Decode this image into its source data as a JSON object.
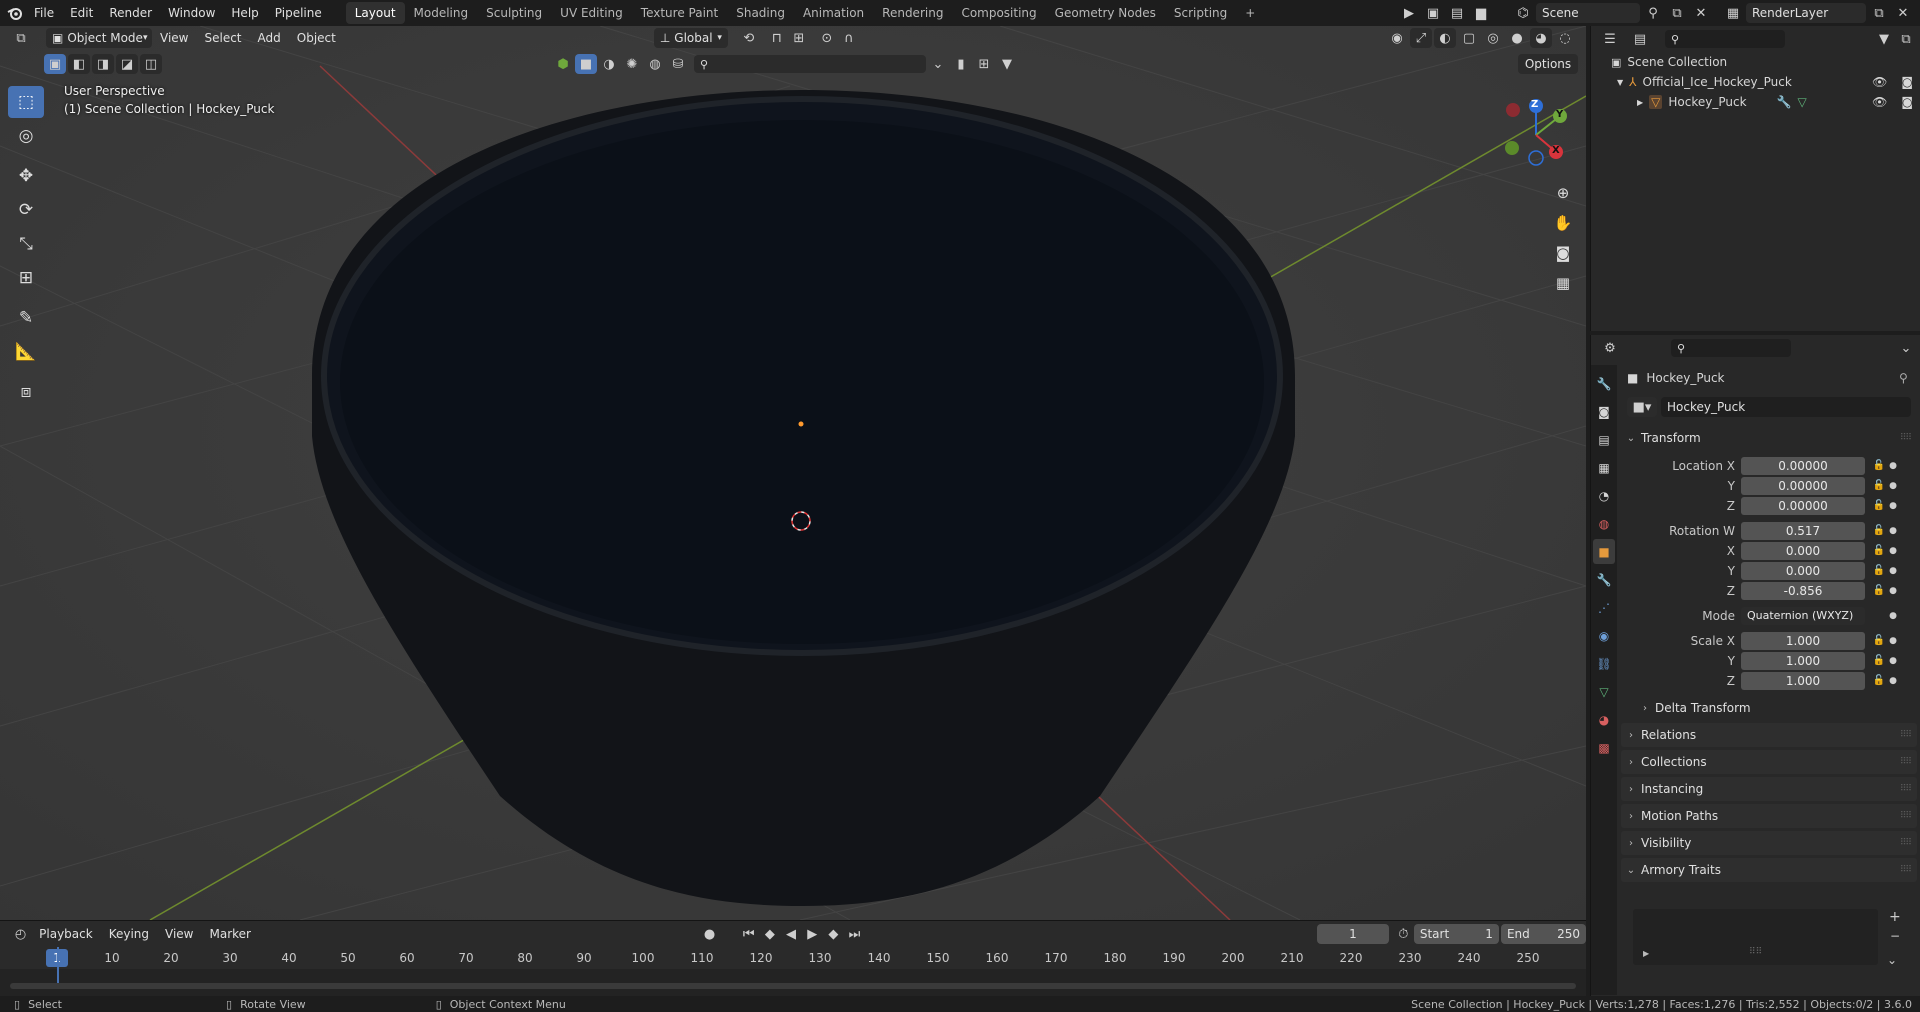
{
  "topbar": {
    "menus": [
      "File",
      "Edit",
      "Render",
      "Window",
      "Help",
      "Pipeline"
    ],
    "workspaces": [
      "Layout",
      "Modeling",
      "Sculpting",
      "UV Editing",
      "Texture Paint",
      "Shading",
      "Animation",
      "Rendering",
      "Compositing",
      "Geometry Nodes",
      "Scripting"
    ],
    "active_workspace": "Layout",
    "add_workspace": "+",
    "scene_name": "Scene",
    "view_layer": "RenderLayer"
  },
  "viewport": {
    "mode": "Object Mode",
    "menus": [
      "View",
      "Select",
      "Add",
      "Object"
    ],
    "transform_orientation": "Global",
    "options_label": "Options",
    "view_name": "User Perspective",
    "collection_info": "(1) Scene Collection | Hockey_Puck",
    "gizmo_axes": {
      "x": "X",
      "y": "Y",
      "z": "Z"
    }
  },
  "outliner": {
    "root": "Scene Collection",
    "items": [
      {
        "name": "Official_Ice_Hockey_Puck",
        "level": 1
      },
      {
        "name": "Hockey_Puck",
        "level": 2
      }
    ]
  },
  "properties": {
    "object_name": "Hockey_Puck",
    "data_name": "Hockey_Puck",
    "transform_header": "Transform",
    "location": {
      "label": "Location X",
      "x": "0.00000",
      "y": "0.00000",
      "z": "0.00000"
    },
    "rotation": {
      "label": "Rotation W",
      "w": "0.517",
      "x": "0.000",
      "y": "0.000",
      "z": "-0.856"
    },
    "mode_label": "Mode",
    "mode_value": "Quaternion (WXYZ)",
    "scale": {
      "label": "Scale X",
      "x": "1.000",
      "y": "1.000",
      "z": "1.000"
    },
    "axis_labels": {
      "x": "X",
      "y": "Y",
      "z": "Z"
    },
    "delta_transform": "Delta Transform",
    "panels": [
      "Relations",
      "Collections",
      "Instancing",
      "Motion Paths",
      "Visibility"
    ],
    "armory_traits": "Armory Traits"
  },
  "timeline": {
    "menus": [
      "Playback",
      "Keying",
      "View",
      "Marker"
    ],
    "current_frame": "1",
    "start_label": "Start",
    "start_value": "1",
    "end_label": "End",
    "end_value": "250",
    "ticks": [
      "10",
      "20",
      "30",
      "40",
      "50",
      "60",
      "70",
      "80",
      "90",
      "100",
      "110",
      "120",
      "130",
      "140",
      "150",
      "160",
      "170",
      "180",
      "190",
      "200",
      "210",
      "220",
      "230",
      "240",
      "250"
    ]
  },
  "statusbar": {
    "select": "Select",
    "rotate": "Rotate View",
    "context": "Object Context Menu",
    "stats": "Scene Collection | Hockey_Puck | Verts:1,278 | Faces:1,276 | Tris:2,552 | Objects:0/2 | 3.6.0"
  },
  "colors": {
    "accent": "#4772b3",
    "header": "#1d1d1d",
    "panel": "#282828",
    "viewport": "#393939"
  }
}
